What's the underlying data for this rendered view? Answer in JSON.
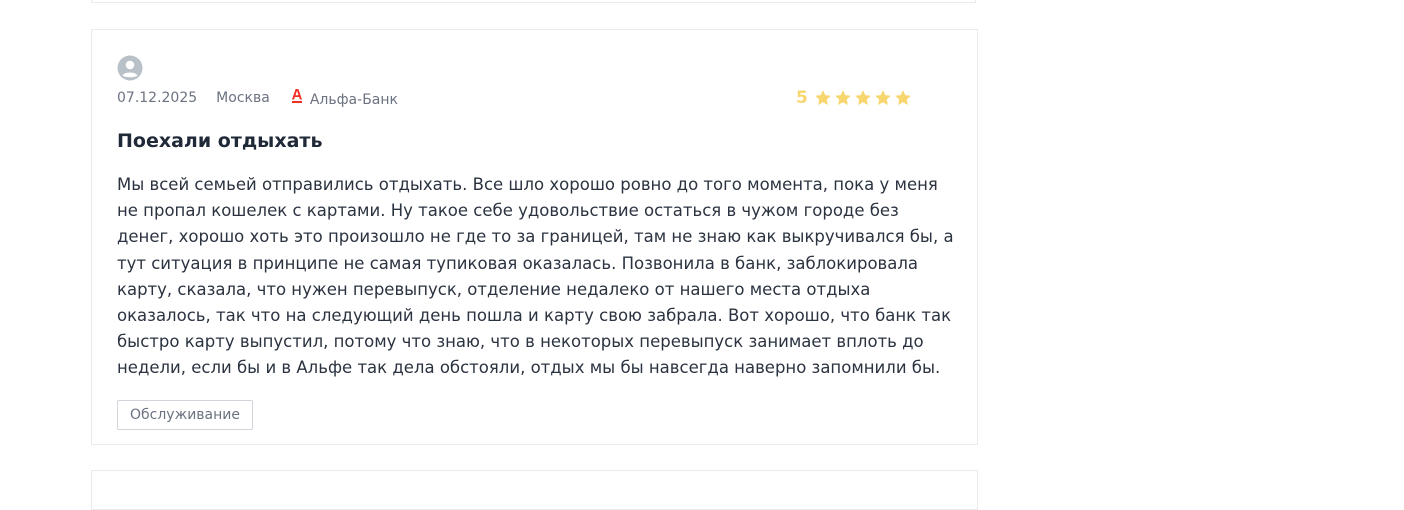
{
  "review": {
    "date": "07.12.2025",
    "city": "Москва",
    "bank": "Альфа-Банк",
    "rating": "5",
    "stars_filled": 5,
    "title": "Поехали отдыхать",
    "text": "Мы всей семьей отправились отдыхать. Все шло хорошо ровно до того момента, пока у меня не пропал кошелек с картами. Ну такое себе удовольствие остаться в чужом городе без денег, хорошо хоть это произошло не где то за границей, там не знаю как выкручивался бы, а тут ситуация в принципе не самая тупиковая оказалась. Позвонила в банк, заблокировала карту, сказала, что нужен перевыпуск, отделение недалеко от нашего места отдыха оказалось, так что на следующий день пошла и карту свою забрала. Вот хорошо, что банк так быстро карту выпустил, потому что знаю, что в некоторых перевыпуск занимает вплоть до недели, если бы и в Альфе так дела обстояли, отдых мы бы навсегда наверно запомнили бы.",
    "tag": "Обслуживание"
  },
  "colors": {
    "star": "#f8d66f",
    "bank_logo": "#ef3124",
    "border": "#e8ebee",
    "avatar": "#b8c0c8"
  },
  "icons": {
    "avatar": "user-avatar-icon",
    "bank_logo": "alfa-bank-logo-icon",
    "star": "star-icon"
  }
}
